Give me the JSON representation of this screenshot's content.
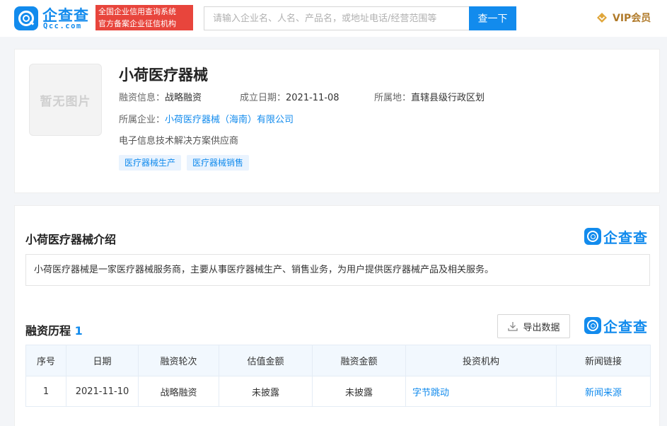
{
  "header": {
    "logo_cn": "企查查",
    "logo_en": "Qcc.com",
    "slogan_line1": "全国企业信用查询系统",
    "slogan_line2": "官方备案企业征信机构",
    "search_placeholder": "请输入企业名、人名、产品名，或地址电话/经营范围等",
    "search_button": "查一下",
    "vip_label": "VIP会员"
  },
  "profile": {
    "no_image_text": "暂无图片",
    "name": "小荷医疗器械",
    "financing_label": "融资信息：",
    "financing_value": "战略融资",
    "founded_label": "成立日期：",
    "founded_value": "2021-11-08",
    "location_label": "所属地：",
    "location_value": "直辖县级行政区划",
    "company_label": "所属企业：",
    "company_value": "小荷医疗器械（海南）有限公司",
    "description": "电子信息技术解决方案供应商",
    "tags": [
      "医疗器械生产",
      "医疗器械销售"
    ]
  },
  "intro": {
    "title": "小荷医疗器械介绍",
    "watermark": "企查查",
    "text": "小荷医疗器械是一家医疗器械服务商，主要从事医疗器械生产、销售业务，为用户提供医疗器械产品及相关服务。"
  },
  "financing": {
    "title": "融资历程",
    "count": "1",
    "export_label": "导出数据",
    "watermark": "企查查",
    "columns": [
      "序号",
      "日期",
      "融资轮次",
      "估值金额",
      "融资金额",
      "投资机构",
      "新闻链接"
    ],
    "rows": [
      {
        "index": "1",
        "date": "2021-11-10",
        "round": "战略融资",
        "valuation": "未披露",
        "amount": "未披露",
        "investor": "字节跳动",
        "news": "新闻来源"
      }
    ]
  },
  "colors": {
    "brand_blue": "#128bed",
    "slogan_red": "#e8453c",
    "vip_gold": "#b07a2a"
  }
}
